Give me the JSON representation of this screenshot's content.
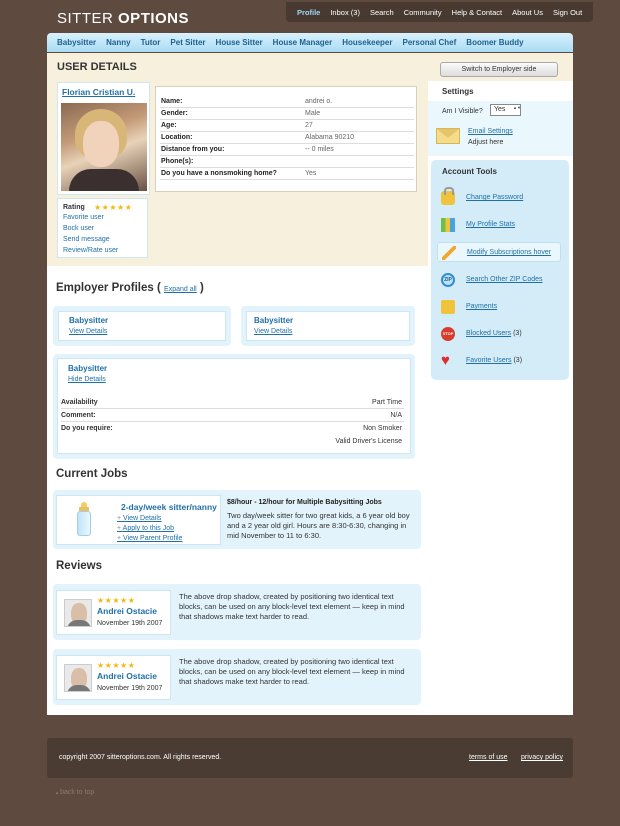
{
  "logo": {
    "part1": "SITTER ",
    "part2": "OPTIONS"
  },
  "topnav": [
    "Profile",
    "Inbox (3)",
    "Search",
    "Community",
    "Help & Contact",
    "About Us",
    "Sign Out"
  ],
  "catnav": [
    "Babysitter",
    "Nanny",
    "Tutor",
    "Pet Sitter",
    "House Sitter",
    "House Manager",
    "Housekeeper",
    "Personal Chef",
    "Boomer Buddy"
  ],
  "user_details": {
    "title": "USER DETAILS",
    "name": "Florian Cristian U.",
    "rows": [
      {
        "k": "Name:",
        "v": "andrei o."
      },
      {
        "k": "Gender:",
        "v": "Male"
      },
      {
        "k": "Age:",
        "v": "27"
      },
      {
        "k": "Location:",
        "v": "Alabama 90210"
      },
      {
        "k": "Distance from you:",
        "v": "-- 0 miles"
      },
      {
        "k": "Phone(s):",
        "v": ""
      },
      {
        "k": "Do you have a nonsmoking home?",
        "v": "Yes"
      }
    ],
    "rating_label": "Rating",
    "rating_stars": "★★★★★",
    "rating_value": 5,
    "links": [
      "Favorite user",
      "Bock user",
      "Send message",
      "Review/Rate user"
    ]
  },
  "employer": {
    "title": "Employer Profiles",
    "paren_open": "(",
    "paren_close": ")",
    "expand_all": "Expand all",
    "cards": [
      {
        "title": "Babysitter",
        "link": "View Details"
      },
      {
        "title": "Babysitter",
        "link": "View Details"
      }
    ],
    "expanded": {
      "title": "Babysitter",
      "link": "Hide Details",
      "rows": [
        {
          "k": "Availability",
          "v": "Part Time"
        },
        {
          "k": "Comment:",
          "v": "N/A"
        },
        {
          "k": "Do you require:",
          "v": "Non Smoker"
        },
        {
          "k": "",
          "v": "Valid Driver's License"
        }
      ]
    }
  },
  "jobs": {
    "title": "Current Jobs",
    "job_title": "2-day/week sitter/nanny",
    "links": [
      "View Details",
      "Apply to this Job",
      "View Parent Profile"
    ],
    "headline": "$8/hour - 12/hour for Multiple Babysitting Jobs",
    "description": "Two day/week sitter for two great kids, a 6 year old boy and a 2 year old girl. Hours are 8:30-6:30, changing in mid November to 11 to 6:30."
  },
  "reviews": {
    "title": "Reviews",
    "items": [
      {
        "stars": "★★★★★",
        "name": "Andrei Ostacie",
        "date": "November 19th 2007",
        "text": "The above drop shadow, created by positioning two identical text blocks, can be used on any block-level text element — keep in mind that shadows make text harder to read."
      },
      {
        "stars": "★★★★★",
        "name": "Andrei Ostacie",
        "date": "November 19th 2007",
        "text": "The above drop shadow, created by positioning two identical text blocks, can be used on any block-level text element — keep in mind that shadows make text harder to read."
      }
    ]
  },
  "sidebar": {
    "switch_label": "Switch to Employer side",
    "settings_title": "Settings",
    "visible_label": "Am I Visible?",
    "visible_value": "Yes",
    "email_settings": "Email Settings",
    "adjust_here": "Adjust here",
    "tools_title": "Account Tools",
    "tools": [
      {
        "label": "Change Password",
        "icon": "lock-icon",
        "count": ""
      },
      {
        "label": "My Profile Stats",
        "icon": "stats-icon",
        "count": ""
      },
      {
        "label": "Modify Subscriptions hover",
        "icon": "pencil-icon",
        "count": ""
      },
      {
        "label": "Search Other ZIP Codes",
        "icon": "zip-icon",
        "count": ""
      },
      {
        "label": "Payments",
        "icon": "coins-icon",
        "count": ""
      },
      {
        "label": "Blocked Users",
        "icon": "stop-icon",
        "count": "(3)"
      },
      {
        "label": "Favorite Users",
        "icon": "heart-icon",
        "count": "(3)"
      }
    ]
  },
  "footer": {
    "copyright": "copyright 2007 sitteroptions.com. All rights reserved.",
    "terms": "terms of use",
    "privacy": "privacy policy",
    "back_to_top": "back to top"
  }
}
